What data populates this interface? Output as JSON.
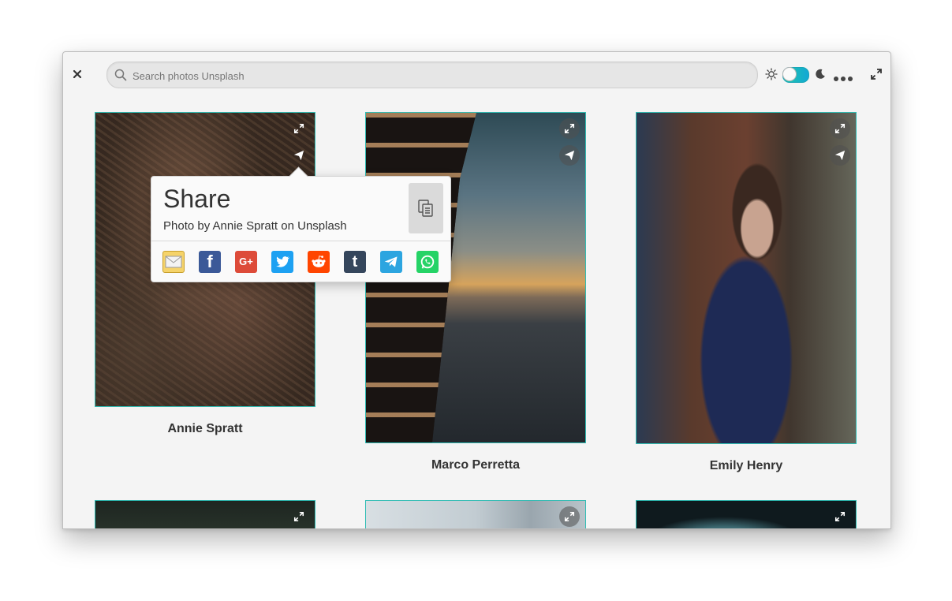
{
  "header": {
    "search_placeholder": "Search photos Unsplash",
    "close_icon": "close-icon",
    "theme_light_icon": "sun-icon",
    "theme_dark_icon": "moon-icon",
    "menu_icon": "more-dots-icon",
    "maximize_icon": "maximize-icon",
    "dark_mode_toggle_on": false
  },
  "photos": [
    {
      "photographer": "Annie Spratt"
    },
    {
      "photographer": "Marco Perretta"
    },
    {
      "photographer": "Emily Henry"
    }
  ],
  "share_popover": {
    "title": "Share",
    "subtitle": "Photo by Annie Spratt on Unsplash",
    "copy_icon": "copy-link-icon",
    "services": [
      {
        "name": "Email",
        "icon": "email-icon",
        "color": "#f2c44a"
      },
      {
        "name": "Facebook",
        "icon": "facebook-icon",
        "glyph": "f",
        "color": "#3b5998"
      },
      {
        "name": "Google+",
        "icon": "google-plus-icon",
        "glyph": "G+",
        "color": "#dd4b39"
      },
      {
        "name": "Twitter",
        "icon": "twitter-icon",
        "color": "#1da1f2"
      },
      {
        "name": "Reddit",
        "icon": "reddit-icon",
        "color": "#ff4500"
      },
      {
        "name": "Tumblr",
        "icon": "tumblr-icon",
        "glyph": "t",
        "color": "#35465c"
      },
      {
        "name": "Telegram",
        "icon": "telegram-icon",
        "color": "#2ca5e0"
      },
      {
        "name": "WhatsApp",
        "icon": "whatsapp-icon",
        "color": "#25d366"
      }
    ]
  },
  "colors": {
    "accent": "#2fbdb4",
    "toggle_start": "#1fc7a6",
    "toggle_end": "#13a8d6"
  }
}
